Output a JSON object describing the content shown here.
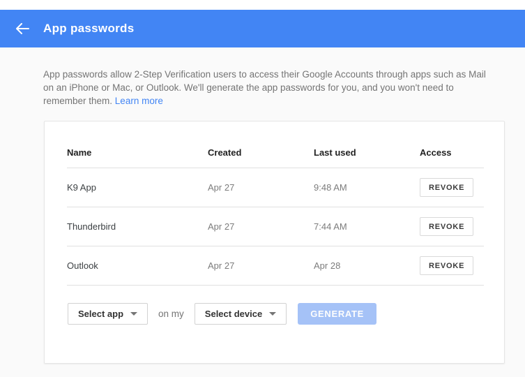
{
  "header": {
    "title": "App passwords",
    "bar_color": "#4285f4",
    "back_icon": "arrow-left"
  },
  "description": {
    "text": "App passwords allow 2-Step Verification users to access their Google Accounts through apps such as Mail on an iPhone or Mac, or Outlook. We'll generate the app passwords for you, and you won't need to remember them.",
    "link_label": "Learn more",
    "link_color": "#4285f4"
  },
  "table": {
    "columns": [
      "Name",
      "Created",
      "Last used",
      "Access"
    ],
    "rows": [
      {
        "name": "K9 App",
        "created": "Apr 27",
        "last_used": "9:48 AM",
        "action": "REVOKE"
      },
      {
        "name": "Thunderbird",
        "created": "Apr 27",
        "last_used": "7:44 AM",
        "action": "REVOKE"
      },
      {
        "name": "Outlook",
        "created": "Apr 27",
        "last_used": "Apr 28",
        "action": "REVOKE"
      }
    ]
  },
  "generator": {
    "app_select": "Select app",
    "conjunction": "on my",
    "device_select": "Select device",
    "generate_label": "GENERATE",
    "generate_disabled_color": "#a5c2f7"
  }
}
